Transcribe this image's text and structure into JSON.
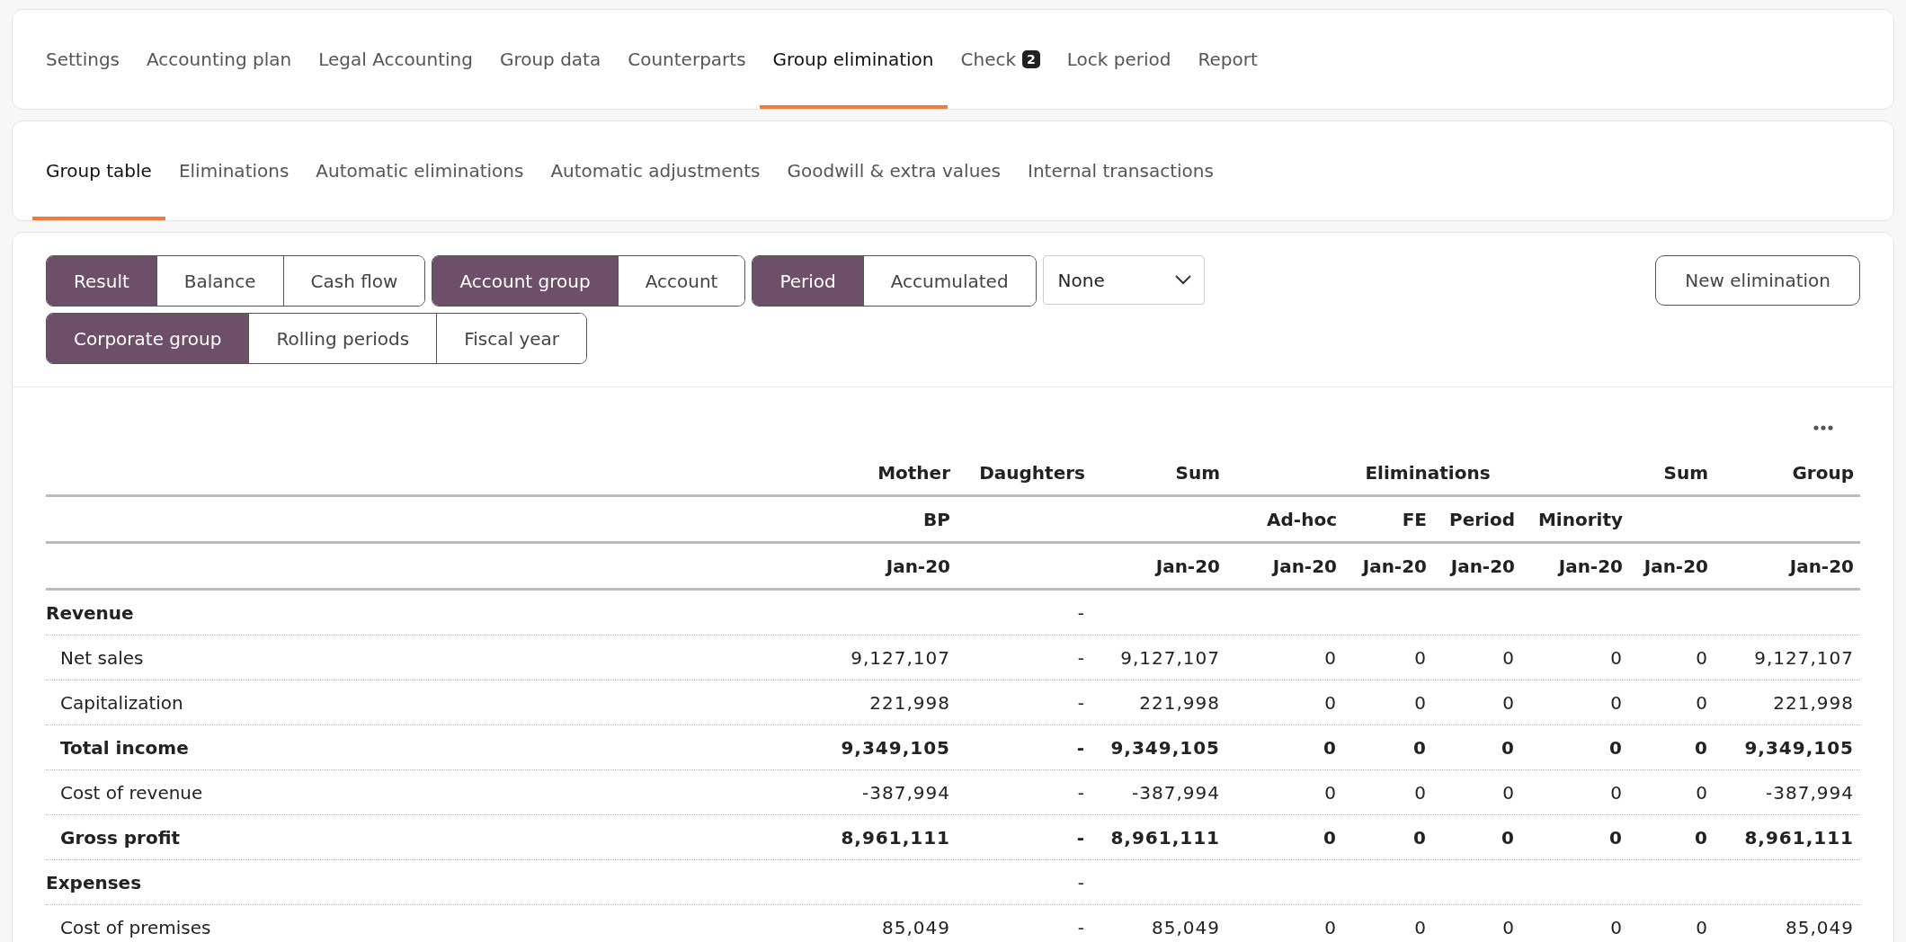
{
  "main_tabs": [
    {
      "label": "Settings",
      "selected": false
    },
    {
      "label": "Accounting plan",
      "selected": false
    },
    {
      "label": "Legal Accounting",
      "selected": false
    },
    {
      "label": "Group data",
      "selected": false
    },
    {
      "label": "Counterparts",
      "selected": false
    },
    {
      "label": "Group elimination",
      "selected": true
    },
    {
      "label": "Check",
      "badge": "2",
      "selected": false
    },
    {
      "label": "Lock period",
      "selected": false
    },
    {
      "label": "Report",
      "selected": false
    }
  ],
  "sub_tabs": [
    {
      "label": "Group table",
      "selected": true
    },
    {
      "label": "Eliminations",
      "selected": false
    },
    {
      "label": "Automatic eliminations",
      "selected": false
    },
    {
      "label": "Automatic adjustments",
      "selected": false
    },
    {
      "label": "Goodwill & extra values",
      "selected": false
    },
    {
      "label": "Internal transactions",
      "selected": false
    }
  ],
  "filter_rows": [
    {
      "groups": [
        [
          {
            "label": "Result",
            "selected": true
          },
          {
            "label": "Balance",
            "selected": false
          },
          {
            "label": "Cash flow",
            "selected": false
          }
        ],
        [
          {
            "label": "Account group",
            "selected": true
          },
          {
            "label": "Account",
            "selected": false
          }
        ],
        [
          {
            "label": "Period",
            "selected": true
          },
          {
            "label": "Accumulated",
            "selected": false
          }
        ]
      ],
      "select": "None"
    },
    {
      "groups": [
        [
          {
            "label": "Corporate group",
            "selected": true
          },
          {
            "label": "Rolling periods",
            "selected": false
          },
          {
            "label": "Fiscal year",
            "selected": false
          }
        ]
      ]
    }
  ],
  "new_button": "New elimination",
  "table": {
    "group_title": "Eliminations",
    "columns": [
      {
        "kind": "single",
        "title": "Mother",
        "sub": "BP",
        "period": "Jan-20"
      },
      {
        "kind": "single",
        "title": "Daughters"
      },
      {
        "kind": "single",
        "title": "Sum",
        "period": "Jan-20"
      },
      {
        "kind": "grouped",
        "sub": "Ad-hoc",
        "period": "Jan-20"
      },
      {
        "kind": "grouped",
        "sub": "FE",
        "period": "Jan-20"
      },
      {
        "kind": "grouped",
        "sub": "Period",
        "period": "Jan-20"
      },
      {
        "kind": "grouped",
        "sub": "Minority",
        "period": "Jan-20"
      },
      {
        "kind": "single",
        "title": "Sum",
        "period": "Jan-20"
      },
      {
        "kind": "single",
        "title": "Group",
        "period": "Jan-20"
      }
    ],
    "rows": [
      {
        "kind": "section",
        "label": "Revenue",
        "cells": [
          null,
          "-",
          null,
          null,
          null,
          null,
          null,
          null,
          null
        ]
      },
      {
        "kind": "item",
        "label": "Net sales",
        "cells": [
          "9,127,107",
          "-",
          "9,127,107",
          "0",
          "0",
          "0",
          "0",
          "0",
          "9,127,107"
        ]
      },
      {
        "kind": "item",
        "label": "Capitalization",
        "cells": [
          "221,998",
          "-",
          "221,998",
          "0",
          "0",
          "0",
          "0",
          "0",
          "221,998"
        ]
      },
      {
        "kind": "total",
        "label": "Total income",
        "cells": [
          "9,349,105",
          "-",
          "9,349,105",
          "0",
          "0",
          "0",
          "0",
          "0",
          "9,349,105"
        ]
      },
      {
        "kind": "item",
        "label": "Cost of revenue",
        "cells": [
          "-387,994",
          "-",
          "-387,994",
          "0",
          "0",
          "0",
          "0",
          "0",
          "-387,994"
        ]
      },
      {
        "kind": "total",
        "label": "Gross profit",
        "cells": [
          "8,961,111",
          "-",
          "8,961,111",
          "0",
          "0",
          "0",
          "0",
          "0",
          "8,961,111"
        ]
      },
      {
        "kind": "section",
        "label": "Expenses",
        "cells": [
          null,
          "-",
          null,
          null,
          null,
          null,
          null,
          null,
          null
        ]
      },
      {
        "kind": "item",
        "label": "Cost of premises",
        "cells": [
          "85,049",
          "-",
          "85,049",
          "0",
          "0",
          "0",
          "0",
          "0",
          "85,049"
        ]
      }
    ]
  }
}
